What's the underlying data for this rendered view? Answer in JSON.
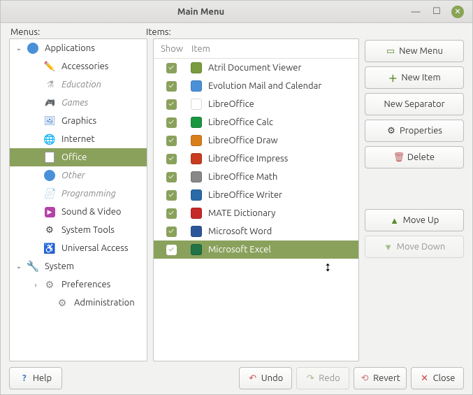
{
  "title": "Main Menu",
  "labels": {
    "menus": "Menus:",
    "items": "Items:"
  },
  "menus": [
    {
      "label": "Applications",
      "type": "root",
      "expanded": true
    },
    {
      "label": "Accessories",
      "type": "child"
    },
    {
      "label": "Education",
      "type": "child",
      "italic": true
    },
    {
      "label": "Games",
      "type": "child",
      "italic": true
    },
    {
      "label": "Graphics",
      "type": "child"
    },
    {
      "label": "Internet",
      "type": "child"
    },
    {
      "label": "Office",
      "type": "child",
      "selected": true
    },
    {
      "label": "Other",
      "type": "child",
      "italic": true
    },
    {
      "label": "Programming",
      "type": "child",
      "italic": true
    },
    {
      "label": "Sound & Video",
      "type": "child"
    },
    {
      "label": "System Tools",
      "type": "child"
    },
    {
      "label": "Universal Access",
      "type": "child"
    },
    {
      "label": "System",
      "type": "root",
      "expanded": true
    },
    {
      "label": "Preferences",
      "type": "pref"
    },
    {
      "label": "Administration",
      "type": "admin"
    }
  ],
  "items_header": {
    "show": "Show",
    "item": "Item"
  },
  "items": [
    {
      "label": "Atril Document Viewer",
      "checked": true,
      "color": "#7a9c3f"
    },
    {
      "label": "Evolution Mail and Calendar",
      "checked": true,
      "color": "#4a90d9"
    },
    {
      "label": "LibreOffice",
      "checked": true,
      "color": "#ffffff"
    },
    {
      "label": "LibreOffice Calc",
      "checked": true,
      "color": "#1a9641"
    },
    {
      "label": "LibreOffice Draw",
      "checked": true,
      "color": "#d97f1a"
    },
    {
      "label": "LibreOffice Impress",
      "checked": true,
      "color": "#c93c20"
    },
    {
      "label": "LibreOffice Math",
      "checked": true,
      "color": "#888888"
    },
    {
      "label": "LibreOffice Writer",
      "checked": true,
      "color": "#2a6aa8"
    },
    {
      "label": "MATE Dictionary",
      "checked": true,
      "color": "#c62828"
    },
    {
      "label": "Microsoft Word",
      "checked": true,
      "color": "#2b579a"
    },
    {
      "label": "Microsoft Excel",
      "checked": true,
      "color": "#217346",
      "selected": true
    }
  ],
  "buttons": {
    "new_menu": "New Menu",
    "new_item": "New Item",
    "new_sep": "New Separator",
    "properties": "Properties",
    "delete": "Delete",
    "move_up": "Move Up",
    "move_down": "Move Down",
    "help": "Help",
    "undo": "Undo",
    "redo": "Redo",
    "revert": "Revert",
    "close": "Close"
  }
}
